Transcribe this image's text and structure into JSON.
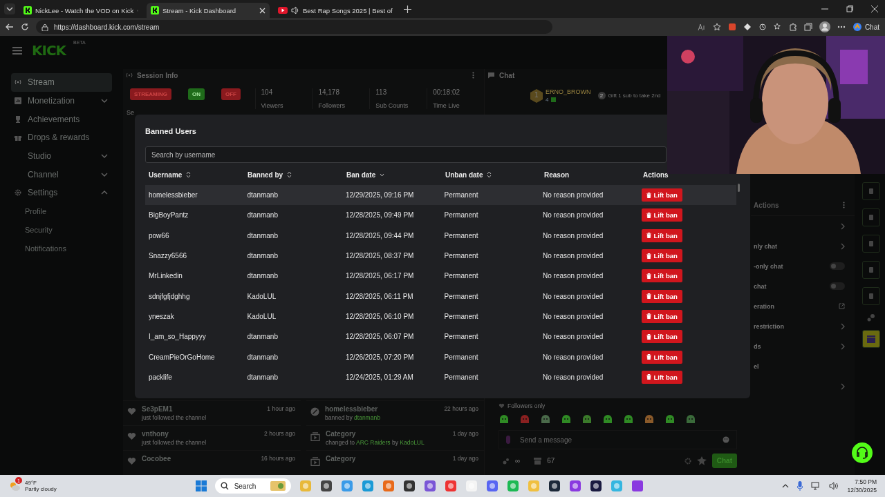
{
  "browser": {
    "tabs": [
      {
        "title": "NickLee - Watch the VOD on Kick",
        "kind": "kick",
        "audio": false,
        "selected": false
      },
      {
        "title": "Stream - Kick Dashboard",
        "kind": "kick",
        "audio": false,
        "selected": true
      },
      {
        "title": "Best Rap Songs 2025 | Best of",
        "kind": "video",
        "audio": true,
        "selected": false
      }
    ],
    "url": "https://dashboard.kick.com/stream",
    "assistant_label": "Chat"
  },
  "header": {
    "logo": "KICK",
    "logo_badge": "BETA"
  },
  "sidebar": {
    "items": [
      {
        "label": "Stream",
        "selected": true
      },
      {
        "label": "Monetization",
        "selected": false,
        "expanded": false
      },
      {
        "label": "Achievements",
        "selected": false
      },
      {
        "label": "Drops & rewards",
        "selected": false
      },
      {
        "label": "Studio",
        "selected": false,
        "expanded": false
      },
      {
        "label": "Channel",
        "selected": false,
        "expanded": false
      },
      {
        "label": "Settings",
        "selected": false,
        "expanded": true,
        "children": [
          {
            "label": "Profile",
            "selected": false
          },
          {
            "label": "Security",
            "selected": false
          },
          {
            "label": "Notifications",
            "selected": false
          }
        ]
      }
    ]
  },
  "session": {
    "title": "Session Info",
    "caption": "Se",
    "badges": [
      {
        "label": "STREAMING",
        "color": "#8a1a1e"
      },
      {
        "label": "ON",
        "color": "#1f6b1a"
      },
      {
        "label": "OFF",
        "color": "#8a1a1e"
      }
    ],
    "stats": [
      {
        "value": "104",
        "label": "Viewers"
      },
      {
        "value": "14,178",
        "label": "Followers"
      },
      {
        "value": "113",
        "label": "Sub Counts"
      },
      {
        "value": "00:18:02",
        "label": "Time Live"
      }
    ]
  },
  "activity_left": [
    {
      "name": "Se3pEM1",
      "note": "just followed the channel",
      "time": "1 hour ago"
    },
    {
      "name": "vnthony",
      "note": "just followed the channel",
      "time": "2 hours ago"
    },
    {
      "name": "Cocobee",
      "time": "16 hours ago"
    }
  ],
  "activity_right": [
    {
      "kind": "ban",
      "title": "homelessbieber",
      "time": "22 hours ago",
      "detail": [
        {
          "text": "banned by ",
          "highlight": false
        },
        {
          "text": "dtanmanb",
          "highlight": true
        }
      ]
    },
    {
      "kind": "category",
      "title": "Category",
      "time": "1 day ago",
      "detail": [
        {
          "text": "changed to ",
          "highlight": false
        },
        {
          "text": "ARC Raiders",
          "highlight": true
        },
        {
          "text": " by ",
          "highlight": false
        },
        {
          "text": "KadoLUL",
          "highlight": true
        }
      ]
    },
    {
      "kind": "category",
      "title": "Category",
      "time": "1 day ago"
    }
  ],
  "chat": {
    "title": "Chat",
    "leader": {
      "rank": "1",
      "name": "ERNO_BROWN",
      "count": "4",
      "gift_rank": "2",
      "gift_hint": "Gift 1 sub to take 2nd"
    },
    "followers_only": "Followers only",
    "placeholder": "Send a message",
    "infinity": "∞",
    "points": "67",
    "send_label": "Chat"
  },
  "actions": {
    "title": "Actions",
    "rows": [
      {
        "kind": "chevron"
      },
      {
        "label": "nly chat",
        "kind": "chevron"
      },
      {
        "label": "-only chat",
        "kind": "toggle",
        "on": false
      },
      {
        "label": "chat",
        "kind": "toggle",
        "on": false
      },
      {
        "label": "eration",
        "kind": "external"
      },
      {
        "label": "restriction",
        "kind": "chevron"
      },
      {
        "label": "ds",
        "kind": "chevron"
      },
      {
        "label": "el",
        "kind": "plain"
      },
      {
        "kind": "chevron"
      }
    ]
  },
  "modal": {
    "title": "Banned Users",
    "search_placeholder": "Search by username",
    "columns": [
      {
        "label": "Username",
        "kind": "sortable"
      },
      {
        "label": "Banned by",
        "kind": "sortable"
      },
      {
        "label": "Ban date",
        "kind": "sorted"
      },
      {
        "label": "Unban date",
        "kind": "sortable"
      },
      {
        "label": "Reason",
        "kind": "plain"
      },
      {
        "label": "Actions",
        "kind": "plain"
      }
    ],
    "rows": [
      {
        "username": "homelessbieber",
        "banned_by": "dtanmanb",
        "ban_date": "12/29/2025, 09:16 PM",
        "unban_date": "Permanent",
        "reason": "No reason provided",
        "action": "Lift ban",
        "selected": true
      },
      {
        "username": "BigBoyPantz",
        "banned_by": "dtanmanb",
        "ban_date": "12/28/2025, 09:49 PM",
        "unban_date": "Permanent",
        "reason": "No reason provided",
        "action": "Lift ban",
        "selected": false
      },
      {
        "username": "pow66",
        "banned_by": "dtanmanb",
        "ban_date": "12/28/2025, 09:44 PM",
        "unban_date": "Permanent",
        "reason": "No reason provided",
        "action": "Lift ban",
        "selected": false
      },
      {
        "username": "Snazzy6566",
        "banned_by": "dtanmanb",
        "ban_date": "12/28/2025, 08:37 PM",
        "unban_date": "Permanent",
        "reason": "No reason provided",
        "action": "Lift ban",
        "selected": false
      },
      {
        "username": "MrLinkedin",
        "banned_by": "dtanmanb",
        "ban_date": "12/28/2025, 06:17 PM",
        "unban_date": "Permanent",
        "reason": "No reason provided",
        "action": "Lift ban",
        "selected": false
      },
      {
        "username": "sdnjfgfjdghhg",
        "banned_by": "KadoLUL",
        "ban_date": "12/28/2025, 06:11 PM",
        "unban_date": "Permanent",
        "reason": "No reason provided",
        "action": "Lift ban",
        "selected": false
      },
      {
        "username": "yneszak",
        "banned_by": "KadoLUL",
        "ban_date": "12/28/2025, 06:10 PM",
        "unban_date": "Permanent",
        "reason": "No reason provided",
        "action": "Lift ban",
        "selected": false
      },
      {
        "username": "I_am_so_Happyyy",
        "banned_by": "dtanmanb",
        "ban_date": "12/28/2025, 06:07 PM",
        "unban_date": "Permanent",
        "reason": "No reason provided",
        "action": "Lift ban",
        "selected": false
      },
      {
        "username": "CreamPieOrGoHome",
        "banned_by": "dtanmanb",
        "ban_date": "12/26/2025, 07:20 PM",
        "unban_date": "Permanent",
        "reason": "No reason provided",
        "action": "Lift ban",
        "selected": false
      },
      {
        "username": "packlife",
        "banned_by": "dtanmanb",
        "ban_date": "12/24/2025, 01:29 AM",
        "unban_date": "Permanent",
        "reason": "No reason provided",
        "action": "Lift ban",
        "selected": false
      }
    ]
  },
  "taskbar": {
    "weather": {
      "temp": "49°F",
      "condition": "Partly cloudy",
      "alert": "1"
    },
    "search": "Search",
    "time": "7:50 PM",
    "date": "12/30/2025"
  }
}
